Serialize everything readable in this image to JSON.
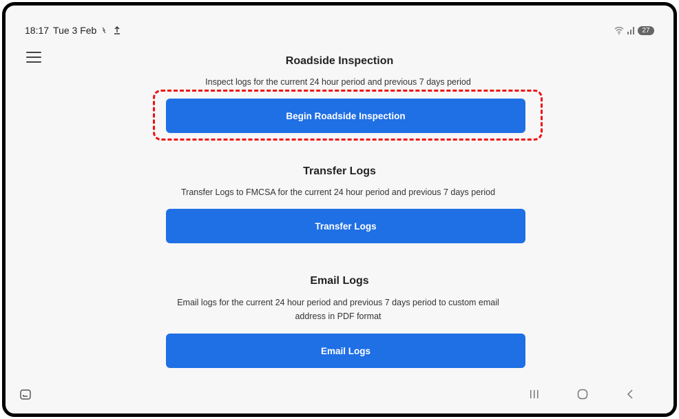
{
  "status_bar": {
    "time": "18:17",
    "date": "Tue 3 Feb",
    "battery": "27"
  },
  "sections": [
    {
      "title": "Roadside Inspection",
      "description": "Inspect logs for the current 24 hour period and previous 7 days period",
      "button_label": "Begin Roadside Inspection"
    },
    {
      "title": "Transfer Logs",
      "description": "Transfer Logs to FMCSA for the current 24 hour period and previous 7 days period",
      "button_label": "Transfer Logs"
    },
    {
      "title": "Email Logs",
      "description": "Email logs for the current 24 hour period and previous 7 days period to custom email address in PDF format",
      "button_label": "Email Logs"
    }
  ],
  "colors": {
    "button": "#1f6fe5",
    "highlight": "#ee1111"
  },
  "icons": {
    "menu": "hamburger-menu-icon",
    "recents": "recent-apps-icon",
    "home": "home-icon",
    "back": "back-icon"
  }
}
